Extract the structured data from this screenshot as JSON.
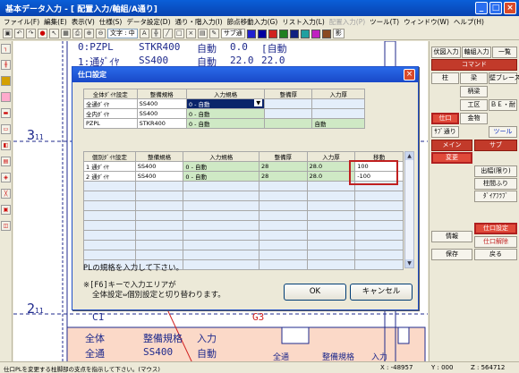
{
  "window": {
    "title": "基本データ入力 - [ 配置入力/軸組/A通り]"
  },
  "menu": [
    "ファイル(F)",
    "編集(E)",
    "表示(V)",
    "仕様(S)",
    "データ設定(D)",
    "通り・階入力(I)",
    "節点移動入力(G)",
    "リスト入力(L)",
    "配置入力(P)",
    "ツール(T)",
    "ウィンドウ(W)",
    "ヘルプ(H)"
  ],
  "toolbar": {
    "text_select": "文字 : 中",
    "layer_label": "サブ通",
    "shadow_label": "影"
  },
  "canvas": {
    "row_top1": "0:PZPL",
    "row_top1_spec": "STKR400",
    "row_top1_mode": "自動",
    "row_top1_v1": "0.0",
    "row_top1_v2": "[自動",
    "row_top2": "1:通ﾀﾞｲﾔ",
    "row_top2_spec": "SS400",
    "row_top2_mode": "自動",
    "row_top2_v1": "22.0",
    "row_top2_v2": "22.0",
    "axis_3": "3",
    "axis_3_sub": "11",
    "axis_2": "2",
    "axis_2_sub": "11",
    "label_c1": "C1",
    "label_g3": "G3",
    "bottom_all": "全体",
    "bottom_spec": "整備規格",
    "bottom_input": "入力",
    "bottom_tsu": "全通",
    "bottom_ss": "SS400",
    "bottom_auto": "自動",
    "bottom_tsu2": "全通",
    "bottom_spec2": "整備規格",
    "bottom_input2": "入力"
  },
  "right_panel": {
    "top_buttons": [
      "伏図入力",
      "軸組入力",
      "一覧"
    ],
    "command_header": "コマンド",
    "member_buttons": [
      "柱",
      "梁",
      "壁ブレース",
      "",
      "柄梁",
      "",
      "",
      "工区",
      "ＢＥ・耐",
      "仕口",
      "金物",
      "",
      "ｻﾌﾞ通り",
      "",
      "ツール"
    ],
    "main_header": "メイン",
    "sub_header": "サブ",
    "change_button": "変更",
    "sub_buttons": [
      "出幅(限り)",
      "柱間ふり",
      "ﾀﾞｲｱﾌﾗﾌﾞ"
    ],
    "info_button": "情報",
    "shiguchi_set": "仕口設定",
    "shiguchi_release": "仕口解除",
    "save_button": "保存",
    "back_button": "戻る"
  },
  "status": {
    "message": "仕口PLを変更する柱脚部の支点を指示して下さい。(マウス)",
    "x": "X : -48957",
    "y": "Y : 000",
    "z": "Z : 564712"
  },
  "dialog": {
    "title": "仕口設定",
    "upper": {
      "headers": [
        "全体ﾀﾞｲﾔ設定",
        "整備規格",
        "入力規格",
        "整備厚",
        "入力厚"
      ],
      "rows": [
        [
          "全通ﾀﾞｲﾔ",
          "SS400",
          "0 - 自動",
          "",
          ""
        ],
        [
          "全内ﾀﾞｲﾔ",
          "SS400",
          "0 - 自動",
          "",
          ""
        ],
        [
          "PZPL",
          "STKR400",
          "0 - 自動",
          "",
          "自動"
        ]
      ]
    },
    "lower": {
      "headers": [
        "個別ﾀﾞｲﾔ設定",
        "整備規格",
        "入力規格",
        "整備厚",
        "入力厚",
        "移動"
      ],
      "rows": [
        [
          "1 通ﾀﾞｲﾔ",
          "SS400",
          "0 - 自動",
          "28",
          "28.0",
          "100"
        ],
        [
          "2 通ﾀﾞｲﾔ",
          "SS400",
          "0 - 自動",
          "28",
          "28.0",
          "-100"
        ]
      ]
    },
    "message": "PLの規格を入力して下さい。",
    "note_line1": "※[F6]キーで入力エリアが",
    "note_line2": "全体設定⇔個別設定と切り替わります。",
    "ok_label": "OK",
    "cancel_label": "キャンセル"
  }
}
